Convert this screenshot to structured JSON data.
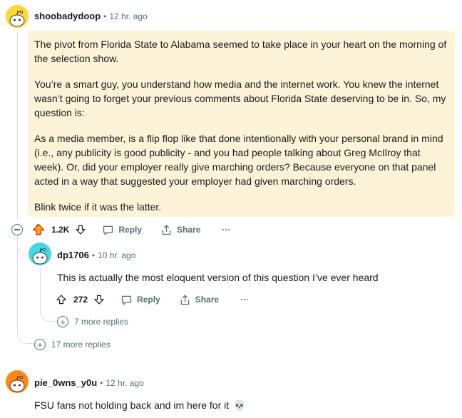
{
  "comments": [
    {
      "username": "shoobadydoop",
      "separator": "•",
      "time": "12 hr. ago",
      "paragraphs": [
        "The pivot from Florida State to Alabama seemed to take place in your heart on the morning of the selection show.",
        "You’re a smart guy, you understand how media and the internet work. You knew the internet wasn’t going to forget your previous comments about Florida State deserving to be in. So, my question is:",
        "As a media member, is a flip flop like that done intentionally with your personal brand in mind (i.e., any publicity is good publicity - and you had people talking about Greg McIlroy that week). Or, did your employer really give marching orders? Because everyone on that panel acted in a way that suggested your employer had given marching orders.",
        "Blink twice if it was the latter."
      ],
      "votes": "1.2K",
      "reply_label": "Reply",
      "share_label": "Share",
      "more_label": "···",
      "upvoted": true,
      "highlight_color": "#fdf3d8",
      "upvote_color": "#d93900"
    },
    {
      "username": "dp1706",
      "separator": "•",
      "time": "10 hr. ago",
      "text": "This is actually the most eloquent version of this question I’ve ever heard",
      "votes": "272",
      "reply_label": "Reply",
      "share_label": "Share",
      "more_label": "···",
      "more_replies": "7 more replies"
    },
    {
      "username": "pie_0wns_y0u",
      "separator": "•",
      "time": "12 hr. ago",
      "text": "FSU fans not holding back and im here for it",
      "emoji": "💀"
    }
  ],
  "thread": {
    "more_replies": "17 more replies"
  },
  "icons": [
    "snoo-avatar-icon",
    "upvote-icon",
    "downvote-icon",
    "reply-icon",
    "share-icon",
    "overflow-icon",
    "collapse-icon",
    "expand-icon",
    "skull-icon"
  ]
}
